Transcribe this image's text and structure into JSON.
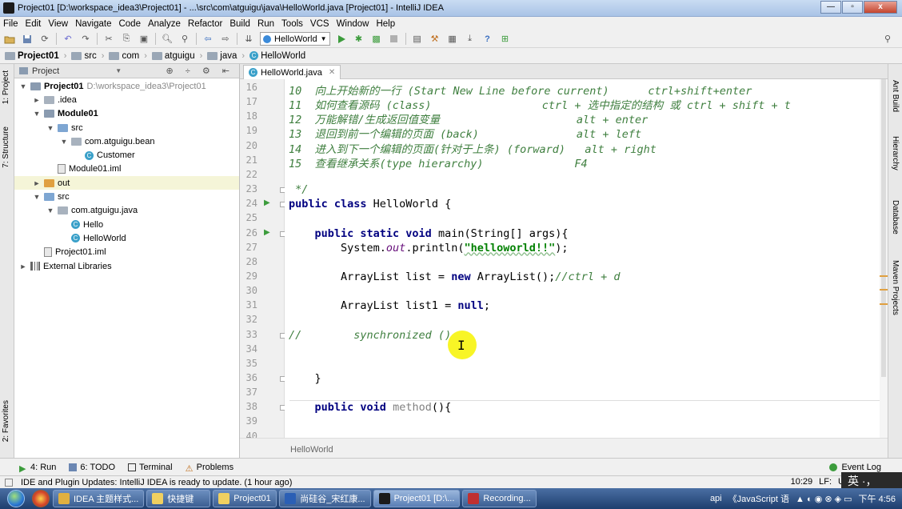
{
  "window": {
    "title": "Project01 [D:\\workspace_idea3\\Project01] - ...\\src\\com\\atguigu\\java\\HelloWorld.java [Project01] - IntelliJ IDEA",
    "buttons": [
      "—",
      "▫",
      "x"
    ]
  },
  "menu": [
    "File",
    "Edit",
    "View",
    "Navigate",
    "Code",
    "Analyze",
    "Refactor",
    "Build",
    "Run",
    "Tools",
    "VCS",
    "Window",
    "Help"
  ],
  "toolbar": {
    "run_config": "HelloWorld",
    "help_icon": "?"
  },
  "breadcrumb": [
    "Project01",
    "src",
    "com",
    "atguigu",
    "java",
    "HelloWorld"
  ],
  "left_tabs": [
    "1: Project",
    "7: Structure",
    "2: Favorites"
  ],
  "right_tabs": [
    "Ant Build",
    "Hierarchy",
    "Database",
    "Maven Projects"
  ],
  "project": {
    "header": "Project",
    "tree": [
      {
        "indent": 0,
        "arrow": "▼",
        "icon": "module",
        "label": "Project01",
        "bold": true,
        "extra": "D:\\workspace_idea3\\Project01"
      },
      {
        "indent": 1,
        "arrow": "►",
        "icon": "folder-gray",
        "label": ".idea"
      },
      {
        "indent": 1,
        "arrow": "▼",
        "icon": "module",
        "label": "Module01",
        "bold": true
      },
      {
        "indent": 2,
        "arrow": "▼",
        "icon": "folder-blue",
        "label": "src"
      },
      {
        "indent": 3,
        "arrow": "▼",
        "icon": "package",
        "label": "com.atguigu.bean"
      },
      {
        "indent": 4,
        "arrow": "",
        "icon": "class",
        "label": "Customer"
      },
      {
        "indent": 2,
        "arrow": "",
        "icon": "file",
        "label": "Module01.iml"
      },
      {
        "indent": 1,
        "arrow": "►",
        "icon": "folder-orange",
        "label": "out",
        "selected": true
      },
      {
        "indent": 1,
        "arrow": "▼",
        "icon": "folder-blue",
        "label": "src"
      },
      {
        "indent": 2,
        "arrow": "▼",
        "icon": "package",
        "label": "com.atguigu.java"
      },
      {
        "indent": 3,
        "arrow": "",
        "icon": "class",
        "label": "Hello"
      },
      {
        "indent": 3,
        "arrow": "",
        "icon": "class",
        "label": "HelloWorld"
      },
      {
        "indent": 1,
        "arrow": "",
        "icon": "file",
        "label": "Project01.iml"
      },
      {
        "indent": 0,
        "arrow": "►",
        "icon": "lib",
        "label": "External Libraries"
      }
    ]
  },
  "editor": {
    "tab": "HelloWorld.java",
    "footer": "HelloWorld",
    "lines": [
      {
        "n": 16,
        "parts": [
          [
            "cm",
            "10  向上开始新的一行 (Start New Line before current)      ctrl+shift+enter"
          ]
        ]
      },
      {
        "n": 17,
        "parts": [
          [
            "cm",
            "11  如何查看源码 (class)                 ctrl + 选中指定的结构 或 ctrl + shift + t"
          ]
        ]
      },
      {
        "n": 18,
        "parts": [
          [
            "cm",
            "12  万能解错/生成返回值变量                     alt + enter"
          ]
        ]
      },
      {
        "n": 19,
        "parts": [
          [
            "cm",
            "13  退回到前一个编辑的页面 (back)               alt + left"
          ]
        ]
      },
      {
        "n": 20,
        "parts": [
          [
            "cm",
            "14  进入到下一个编辑的页面(针对于上条) (forward)   alt + right"
          ]
        ]
      },
      {
        "n": 21,
        "parts": [
          [
            "cm",
            "15  查看继承关系(type hierarchy)              F4"
          ]
        ]
      },
      {
        "n": 22,
        "parts": []
      },
      {
        "n": 23,
        "parts": [
          [
            "cm",
            " */"
          ]
        ]
      },
      {
        "n": 24,
        "run": true,
        "parts": [
          [
            "kw",
            "public class "
          ],
          [
            "",
            "HelloWorld {"
          ]
        ]
      },
      {
        "n": 25,
        "parts": []
      },
      {
        "n": 26,
        "run": true,
        "parts": [
          [
            "",
            "    "
          ],
          [
            "kw",
            "public static void "
          ],
          [
            "",
            "main(String[] args){"
          ]
        ]
      },
      {
        "n": 27,
        "parts": [
          [
            "",
            "        System."
          ],
          [
            "fld",
            "out"
          ],
          [
            "",
            ".println("
          ],
          [
            "str",
            "\"helloworld!!\""
          ],
          [
            "",
            ");"
          ]
        ]
      },
      {
        "n": 28,
        "parts": []
      },
      {
        "n": 29,
        "parts": [
          [
            "",
            "        ArrayList list = "
          ],
          [
            "kw",
            "new "
          ],
          [
            "",
            "ArrayList();"
          ],
          [
            "cm",
            "//ctrl + d"
          ]
        ]
      },
      {
        "n": 30,
        "parts": []
      },
      {
        "n": 31,
        "parts": [
          [
            "",
            "        ArrayList list1 = "
          ],
          [
            "kw",
            "null"
          ],
          [
            "",
            ";"
          ]
        ]
      },
      {
        "n": 32,
        "parts": []
      },
      {
        "n": 33,
        "parts": [
          [
            "cm",
            "//        synchronized ()"
          ]
        ]
      },
      {
        "n": 34,
        "parts": []
      },
      {
        "n": 35,
        "parts": []
      },
      {
        "n": 36,
        "parts": [
          [
            "",
            "    }"
          ]
        ]
      },
      {
        "n": 37,
        "parts": []
      },
      {
        "n": 38,
        "parts": [
          [
            "",
            "    "
          ],
          [
            "kw",
            "public void "
          ],
          [
            "mth",
            "method"
          ],
          [
            "",
            "(){"
          ]
        ]
      },
      {
        "n": 39,
        "parts": []
      },
      {
        "n": 40,
        "parts": []
      }
    ]
  },
  "bottom_tools": [
    "4: Run",
    "6: TODO",
    "Terminal",
    "Problems"
  ],
  "event_log": "Event Log",
  "status": {
    "message": "IDE and Plugin Updates: IntelliJ IDEA is ready to update. (1 hour ago)",
    "position": "10:29",
    "line_sep": "LF:",
    "encoding": "U"
  },
  "ime": "英 ·，",
  "taskbar": {
    "tasks": [
      "IDEA 主题样式...",
      "快捷键",
      "Project01",
      "尚硅谷_宋红康...",
      "Project01 [D:\\...",
      "Recording..."
    ],
    "tray_text": [
      "api",
      "《JavaScript 语",
      "下午 4:56"
    ]
  },
  "colors": {
    "comment": "#3f7f3f",
    "keyword": "#000080",
    "string": "#008000",
    "caret_highlight": "#f7f300"
  }
}
